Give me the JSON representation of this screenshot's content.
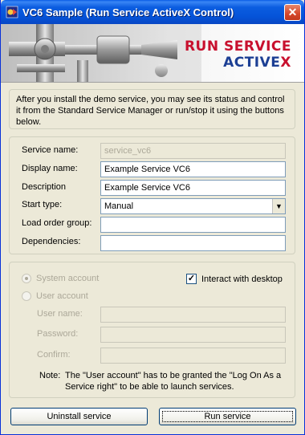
{
  "window": {
    "title": "VC6 Sample (Run Service ActiveX Control)",
    "close_glyph": "✕"
  },
  "banner": {
    "brand_line1": "RUN SERVICE",
    "brand_line2_main": "ACTIVE",
    "brand_line2_accent": "X"
  },
  "intro": {
    "text": "After you install the demo service, you may see its status and control it from the Standard Service Manager or run/stop it using the buttons below."
  },
  "service": {
    "name_label": "Service name:",
    "name_value": "service_vc6",
    "display_label": "Display name:",
    "display_value": "Example Service VC6",
    "description_label": "Description",
    "description_value": "Example Service VC6",
    "start_type_label": "Start type:",
    "start_type_value": "Manual",
    "load_order_label": "Load order group:",
    "load_order_value": "",
    "dependencies_label": "Dependencies:",
    "dependencies_value": ""
  },
  "account": {
    "system_label": "System account",
    "user_label": "User account",
    "interact_label": "Interact with desktop",
    "interact_checked": true,
    "username_label": "User name:",
    "password_label": "Password:",
    "confirm_label": "Confirm:",
    "note_prefix": "Note:",
    "note_text": "The \"User account\" has to be granted the \"Log On As a Service right\" to be able to launch services."
  },
  "buttons": {
    "uninstall": "Uninstall service",
    "run": "Run service"
  },
  "colors": {
    "titlebar": "#0553d8",
    "brand_red": "#c8102e",
    "brand_blue": "#1c3f94"
  }
}
